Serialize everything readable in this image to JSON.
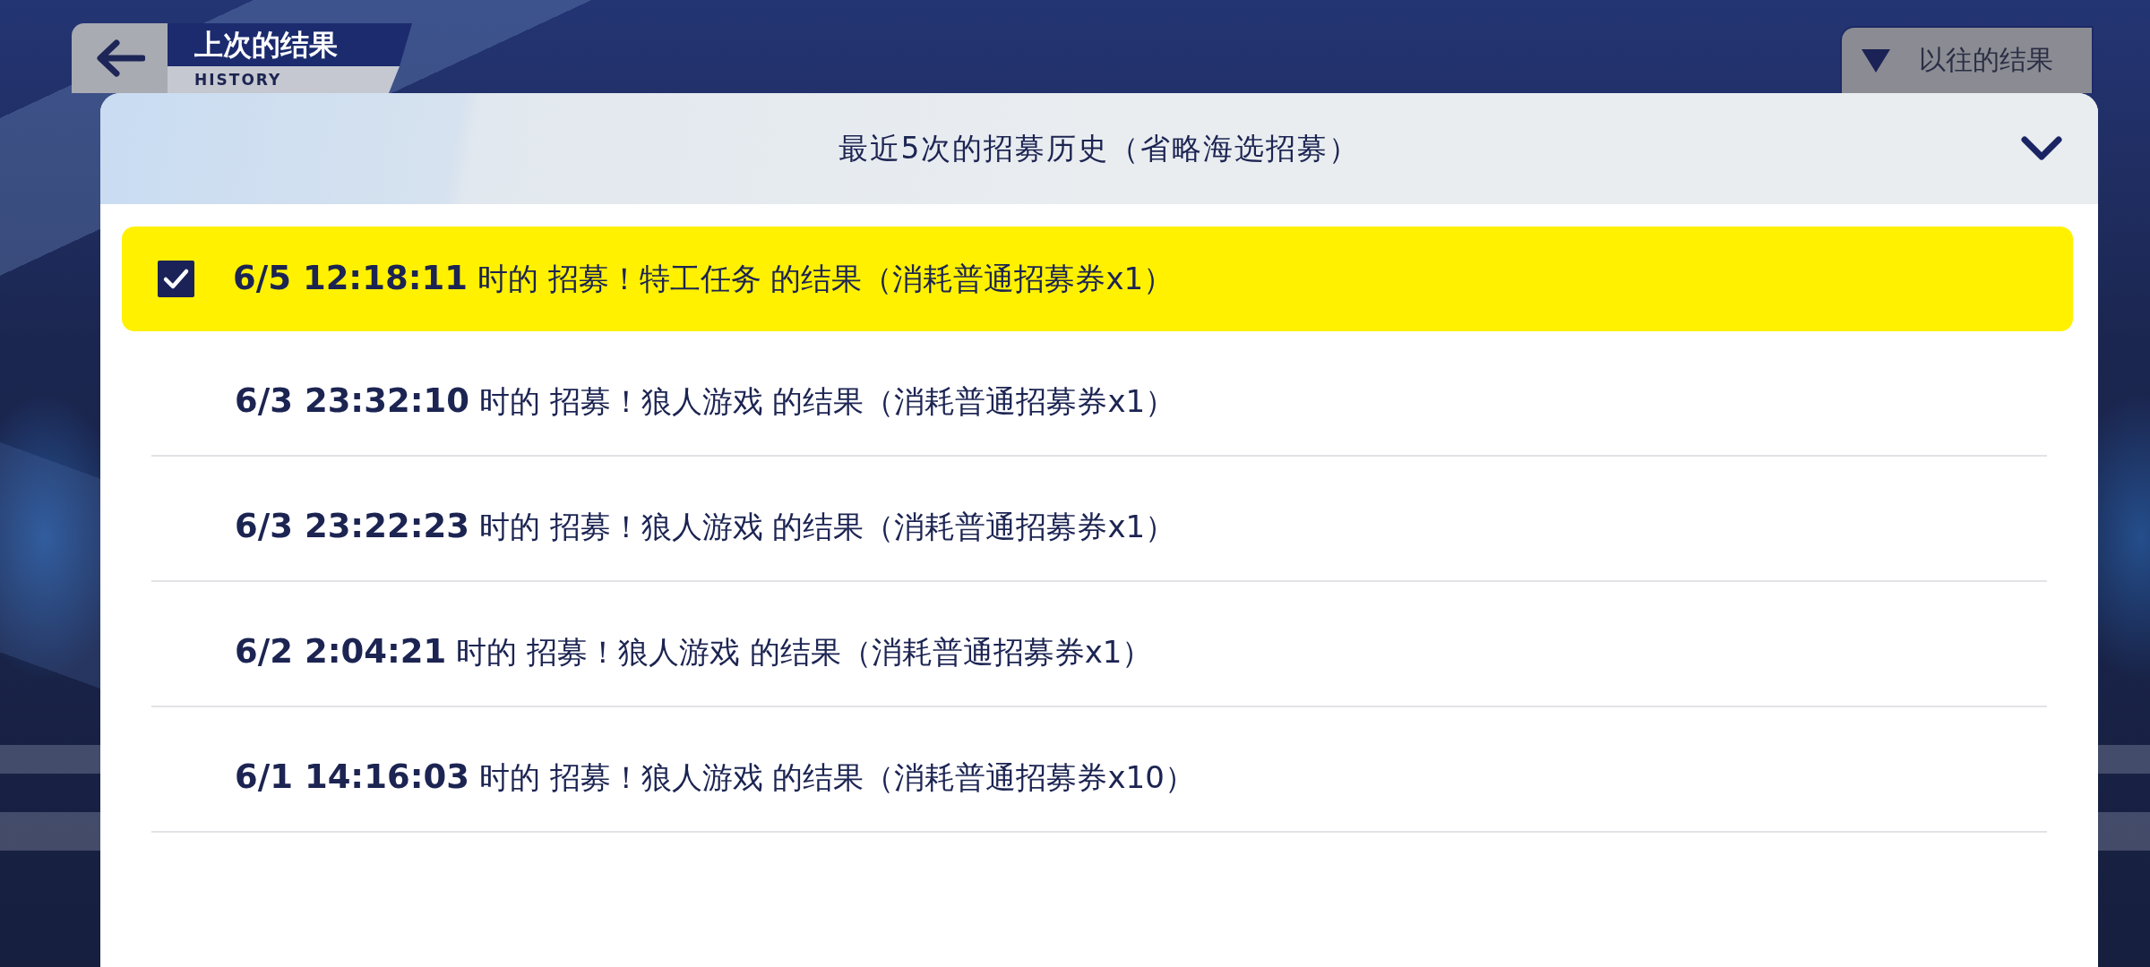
{
  "header": {
    "title": "上次的结果",
    "subtitle": "HISTORY"
  },
  "past_results_button": {
    "label": "以往的结果"
  },
  "panel": {
    "title": "最近5次的招募历史（省略海选招募）",
    "rows": [
      {
        "text": "**6/5 12:18:11** 时的 招募！特工任务 的结果（消耗普通招募券x1）",
        "selected": true
      },
      {
        "text": "**6/3 23:32:10** 时的 招募！狼人游戏 的结果（消耗普通招募券x1）",
        "selected": false
      },
      {
        "text": "**6/3 23:22:23** 时的 招募！狼人游戏 的结果（消耗普通招募券x1）",
        "selected": false
      },
      {
        "text": "**6/2 2:04:21** 时的 招募！狼人游戏 的结果（消耗普通招募券x1）",
        "selected": false
      },
      {
        "text": "**6/1 14:16:03** 时的 招募！狼人游戏 的结果（消耗普通招募券x10）",
        "selected": false
      }
    ]
  }
}
